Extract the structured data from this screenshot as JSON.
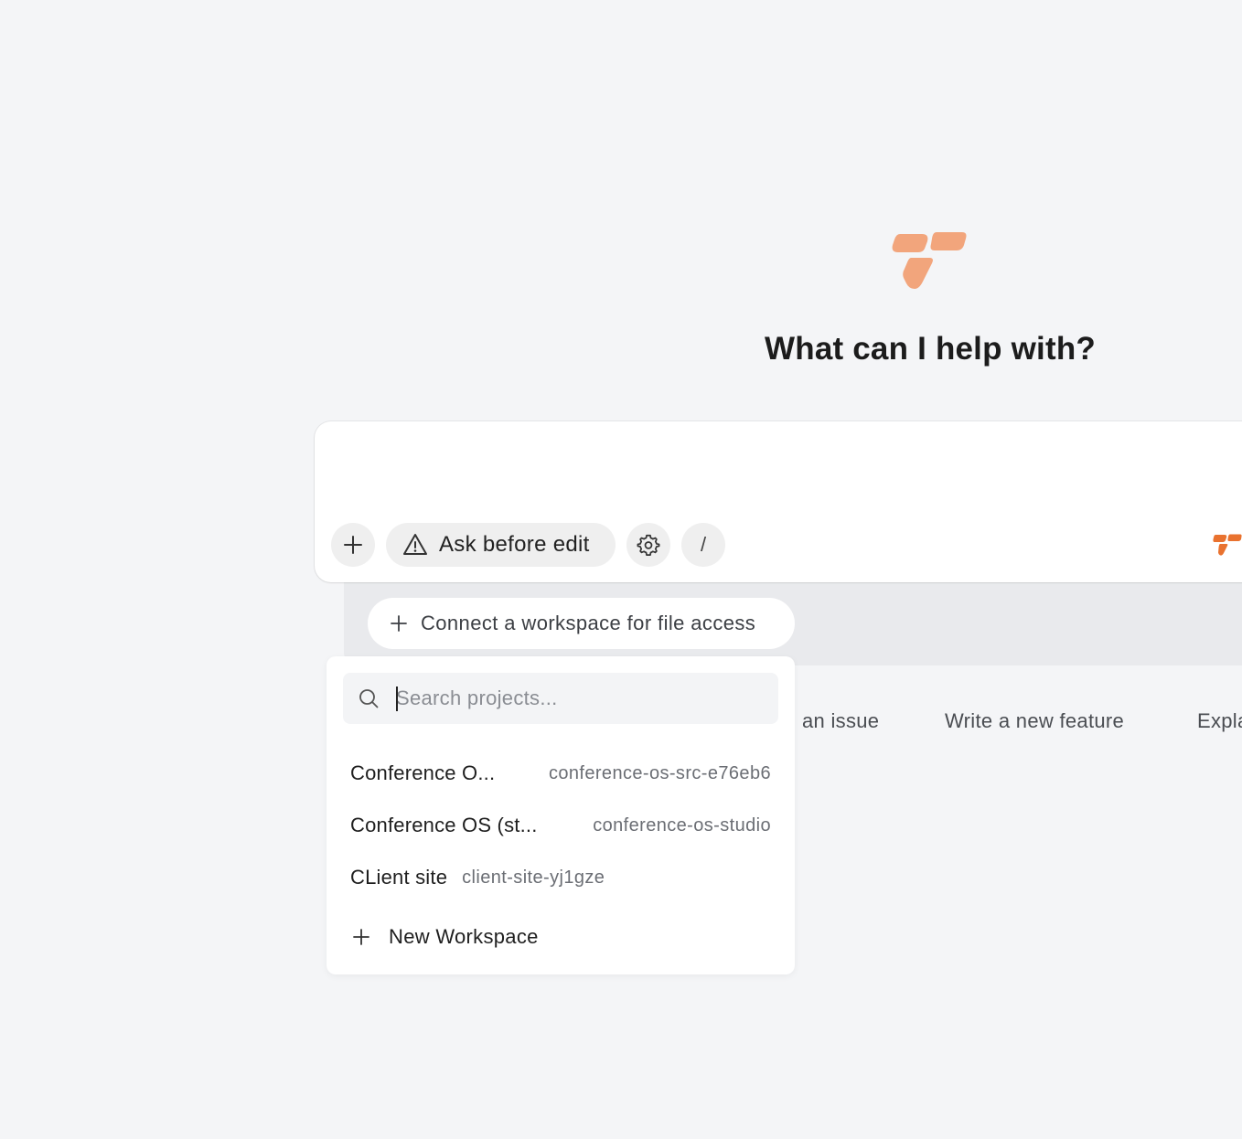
{
  "hero": {
    "title": "What can I help with?"
  },
  "composer": {
    "mode_label": "Ask before edit",
    "slash_label": "/"
  },
  "workspace": {
    "connect_label": "Connect a workspace for file access"
  },
  "suggestions": [
    {
      "label": "an issue"
    },
    {
      "label": "Write a new feature"
    },
    {
      "label": "Expla"
    }
  ],
  "dropdown": {
    "search_placeholder": "Search projects...",
    "projects": [
      {
        "name": "Conference O...",
        "slug": "conference-os-src-e76eb6"
      },
      {
        "name": "Conference OS (st...",
        "slug": "conference-os-studio"
      },
      {
        "name": "CLient site",
        "slug": "client-site-yj1gze"
      }
    ],
    "new_workspace_label": "New Workspace"
  },
  "colors": {
    "brand_light": "#f2a57c",
    "brand": "#e9722f",
    "background": "#f4f5f7"
  }
}
